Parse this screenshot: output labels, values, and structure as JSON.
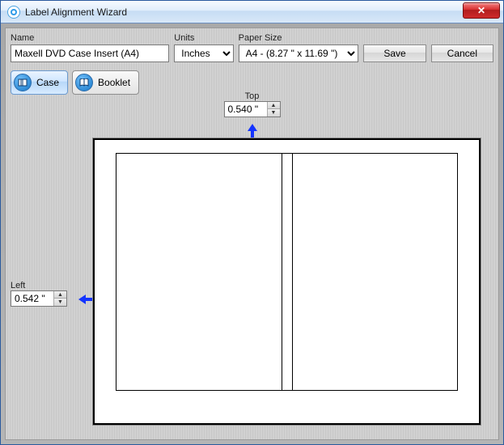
{
  "window": {
    "title": "Label Alignment Wizard",
    "close_label": "✕"
  },
  "fields": {
    "name": {
      "label": "Name",
      "value": "Maxell DVD Case Insert (A4)"
    },
    "units": {
      "label": "Units",
      "selected": "Inches"
    },
    "paper": {
      "label": "Paper Size",
      "selected": "A4 - (8.27 \" x 11.69 \")"
    }
  },
  "buttons": {
    "save": "Save",
    "cancel": "Cancel"
  },
  "tabs": {
    "case": "Case",
    "booklet": "Booklet"
  },
  "measure": {
    "top": {
      "label": "Top",
      "value": "0.540 \""
    },
    "left": {
      "label": "Left",
      "value": "0.542 \""
    }
  }
}
